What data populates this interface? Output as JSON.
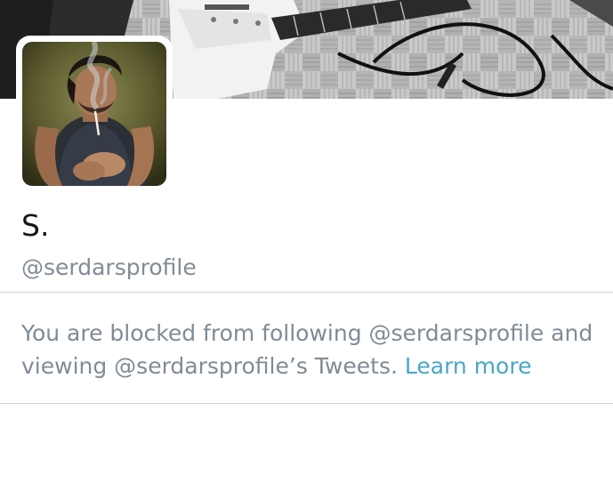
{
  "profile": {
    "display_name": "S.",
    "handle": "@serdarsprofile",
    "banner_image": "guitar-banner-photo",
    "avatar_image": "profile-avatar-photo"
  },
  "blocked_notice": {
    "message": "You are blocked from following @serdarsprofile and viewing @serdarsprofile’s Tweets.",
    "learn_more_label": "Learn more"
  },
  "colors": {
    "text_primary": "#14171a",
    "text_secondary": "#808c97",
    "link": "#4aa6c8",
    "divider": "#ccd6dd"
  }
}
